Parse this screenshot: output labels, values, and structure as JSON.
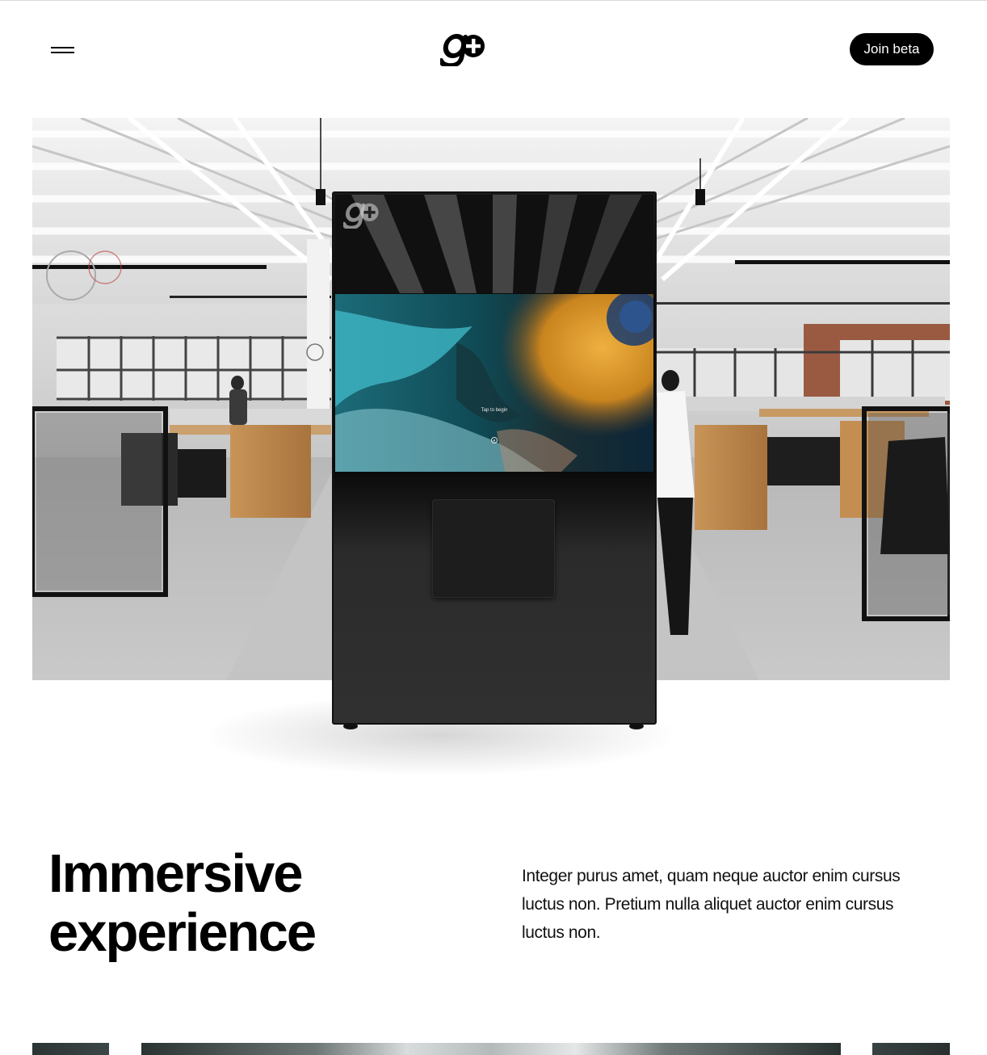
{
  "header": {
    "menu_icon": "hamburger-menu-icon",
    "logo_icon": "g-plus-logo-icon",
    "join_label": "Join beta"
  },
  "hero": {
    "kiosk_screen_text": "Tap to begin",
    "kiosk_logo_icon": "g-plus-logo-icon",
    "accent_colors": [
      "#1a7f8c",
      "#d9962a",
      "#0f2d3c"
    ]
  },
  "feature": {
    "heading_line1": "Immersive",
    "heading_line2": "experience",
    "description": "Integer purus amet, quam neque auctor enim cursus luctus non. Pretium nulla aliquet auctor enim cursus luctus non."
  },
  "colors": {
    "primary": "#000000",
    "background": "#ffffff",
    "button_text": "#ffffff"
  }
}
